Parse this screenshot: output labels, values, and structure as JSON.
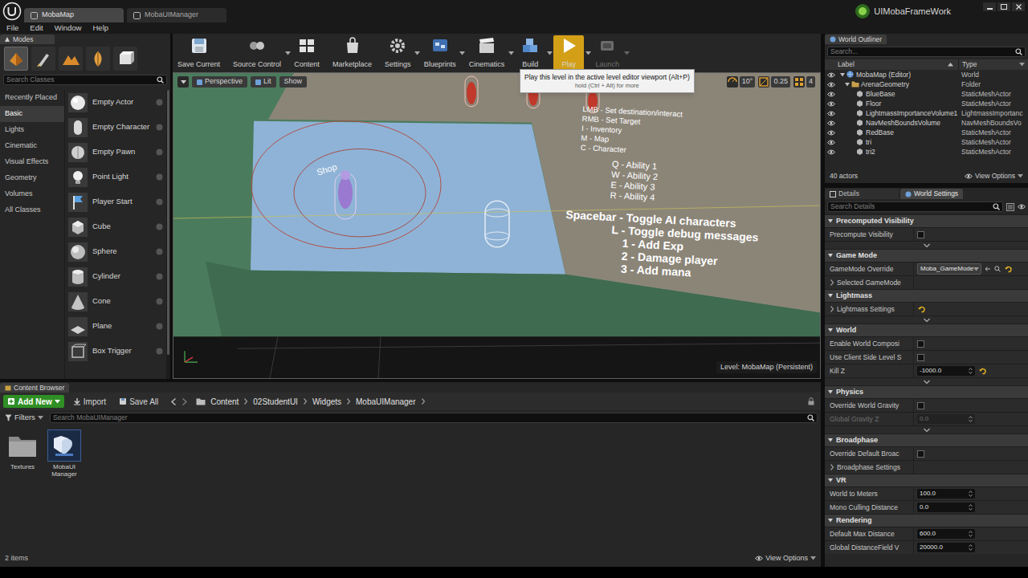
{
  "title_bar": {
    "tabs": [
      {
        "label": "MobaMap",
        "selected": true
      },
      {
        "label": "MobaUIManager",
        "selected": false
      }
    ],
    "project": "UIMobaFrameWork"
  },
  "menu": [
    "File",
    "Edit",
    "Window",
    "Help"
  ],
  "modes": {
    "title": "Modes",
    "tools": [
      {
        "selected": true
      },
      {
        "selected": false
      },
      {
        "selected": false
      },
      {
        "selected": false
      },
      {
        "selected": false
      }
    ],
    "search_placeholder": "Search Classes",
    "categories": [
      {
        "label": "Recently Placed",
        "selected": false
      },
      {
        "label": "Basic",
        "selected": true
      },
      {
        "label": "Lights",
        "selected": false
      },
      {
        "label": "Cinematic",
        "selected": false
      },
      {
        "label": "Visual Effects",
        "selected": false
      },
      {
        "label": "Geometry",
        "selected": false
      },
      {
        "label": "Volumes",
        "selected": false
      },
      {
        "label": "All Classes",
        "selected": false
      }
    ],
    "items": [
      "Empty Actor",
      "Empty Character",
      "Empty Pawn",
      "Point Light",
      "Player Start",
      "Cube",
      "Sphere",
      "Cylinder",
      "Cone",
      "Plane",
      "Box Trigger"
    ]
  },
  "toolbar": [
    {
      "label": "Save Current",
      "dropdown": false,
      "selected": false,
      "disabled": false
    },
    {
      "label": "Source Control",
      "dropdown": true,
      "selected": false,
      "disabled": false
    },
    {
      "label": "Content",
      "dropdown": false,
      "selected": false,
      "disabled": false
    },
    {
      "label": "Marketplace",
      "dropdown": false,
      "selected": false,
      "disabled": false
    },
    {
      "label": "Settings",
      "dropdown": true,
      "selected": false,
      "disabled": false
    },
    {
      "label": "Blueprints",
      "dropdown": true,
      "selected": false,
      "disabled": false
    },
    {
      "label": "Cinematics",
      "dropdown": true,
      "selected": false,
      "disabled": false
    },
    {
      "label": "Build",
      "dropdown": true,
      "selected": false,
      "disabled": false
    },
    {
      "label": "Play",
      "dropdown": true,
      "selected": true,
      "disabled": false
    },
    {
      "label": "Launch",
      "dropdown": true,
      "selected": false,
      "disabled": true
    }
  ],
  "tooltip": {
    "title": "Play this level in the active level editor viewport (Alt+P)",
    "hint": "hold (Ctrl + Alt) for more"
  },
  "viewport": {
    "view_buttons": [
      "Perspective",
      "Lit",
      "Show"
    ],
    "snap": [
      "10°",
      "0.25",
      "4"
    ],
    "level_label": "Level:  MobaMap (Persistent)",
    "shop_label": "Shop",
    "floor_text": [
      "LMB - Set destination/interact",
      "RMB - Set Target",
      "I - Inventory",
      "M - Map",
      "C - Character",
      "Q - Ability 1",
      "W - Ability 2",
      "E - Ability 3",
      "R - Ability 4",
      "Spacebar  - Toggle AI characters",
      "L - Toggle debug messages",
      "1 - Add Exp",
      "2 - Damage player",
      "3 - Add mana"
    ]
  },
  "outliner": {
    "title": "World Outliner",
    "search_placeholder": "Search...",
    "columns": [
      "Label",
      "Type"
    ],
    "rows": [
      {
        "label": "MobaMap (Editor)",
        "type": "World",
        "depth": 0,
        "kind": "world",
        "expanded": true,
        "visible": true
      },
      {
        "label": "ArenaGeometry",
        "type": "Folder",
        "depth": 1,
        "kind": "folder",
        "expanded": true,
        "visible": true
      },
      {
        "label": "BlueBase",
        "type": "StaticMeshActor",
        "depth": 2,
        "kind": "actor",
        "expanded": false,
        "visible": true
      },
      {
        "label": "Floor",
        "type": "StaticMeshActor",
        "depth": 2,
        "kind": "actor",
        "expanded": false,
        "visible": true
      },
      {
        "label": "LightmassImportanceVolume1",
        "type": "LightmassImportanc",
        "depth": 2,
        "kind": "actor",
        "expanded": false,
        "visible": true
      },
      {
        "label": "NavMeshBoundsVolume",
        "type": "NavMeshBoundsVo",
        "depth": 2,
        "kind": "actor",
        "expanded": false,
        "visible": true
      },
      {
        "label": "RedBase",
        "type": "StaticMeshActor",
        "depth": 2,
        "kind": "actor",
        "expanded": false,
        "visible": true
      },
      {
        "label": "tri",
        "type": "StaticMeshActor",
        "depth": 2,
        "kind": "actor",
        "expanded": false,
        "visible": true
      },
      {
        "label": "tri2",
        "type": "StaticMeshActor",
        "depth": 2,
        "kind": "actor",
        "expanded": false,
        "visible": true
      }
    ],
    "count": "40 actors",
    "view_options": "View Options"
  },
  "details": {
    "tabs": [
      {
        "label": "Details",
        "selected": false
      },
      {
        "label": "World Settings",
        "selected": true
      }
    ],
    "search_placeholder": "Search Details",
    "sections": [
      {
        "title": "Precomputed Visibility",
        "expanded": true,
        "advanced": true,
        "rows": [
          {
            "kind": "checkbox",
            "label": "Precompute Visibility",
            "checked": false,
            "disabled": false,
            "modified": false
          }
        ]
      },
      {
        "title": "Game Mode",
        "expanded": true,
        "advanced": false,
        "rows": [
          {
            "kind": "dropdown",
            "label": "GameMode Override",
            "value": "Moba_GameMode",
            "disabled": false,
            "modified": true
          },
          {
            "kind": "group",
            "label": "Selected GameMode",
            "disabled": false,
            "modified": false
          }
        ]
      },
      {
        "title": "Lightmass",
        "expanded": true,
        "advanced": true,
        "rows": [
          {
            "kind": "group",
            "label": "Lightmass Settings",
            "disabled": false,
            "modified": true
          }
        ]
      },
      {
        "title": "World",
        "expanded": true,
        "advanced": true,
        "rows": [
          {
            "kind": "checkbox",
            "label": "Enable World Composi",
            "checked": false,
            "disabled": false,
            "modified": false
          },
          {
            "kind": "checkbox",
            "label": "Use Client Side Level S",
            "checked": false,
            "disabled": false,
            "modified": false
          },
          {
            "kind": "number",
            "label": "Kill Z",
            "value": "-1000.0",
            "disabled": false,
            "modified": true
          }
        ]
      },
      {
        "title": "Physics",
        "expanded": true,
        "advanced": true,
        "rows": [
          {
            "kind": "checkbox",
            "label": "Override World Gravity",
            "checked": false,
            "disabled": false,
            "modified": false
          },
          {
            "kind": "number",
            "label": "Global Gravity Z",
            "value": "0.0",
            "disabled": true,
            "modified": false
          }
        ]
      },
      {
        "title": "Broadphase",
        "expanded": true,
        "advanced": false,
        "rows": [
          {
            "kind": "checkbox",
            "label": "Override Default Broac",
            "checked": false,
            "disabled": false,
            "modified": false
          },
          {
            "kind": "group",
            "label": "Broadphase Settings",
            "disabled": false,
            "modified": false
          }
        ]
      },
      {
        "title": "VR",
        "expanded": true,
        "advanced": false,
        "rows": [
          {
            "kind": "number",
            "label": "World to Meters",
            "value": "100.0",
            "disabled": false,
            "modified": false
          },
          {
            "kind": "number",
            "label": "Mono Culling Distance",
            "value": "0.0",
            "disabled": false,
            "modified": false
          }
        ]
      },
      {
        "title": "Rendering",
        "expanded": true,
        "advanced": false,
        "rows": [
          {
            "kind": "number",
            "label": "Default Max Distance",
            "value": "600.0",
            "disabled": false,
            "modified": false
          },
          {
            "kind": "number",
            "label": "Global DistanceField V",
            "value": "20000.0",
            "disabled": false,
            "modified": false
          }
        ]
      }
    ]
  },
  "content_browser": {
    "title": "Content Browser",
    "buttons": [
      "Add New",
      "Import",
      "Save All"
    ],
    "path": [
      "Content",
      "02StudentUI",
      "Widgets",
      "MobaUIManager"
    ],
    "filters": "Filters",
    "search_placeholder": "Search MobaUIManager",
    "assets": [
      {
        "label": "Textures",
        "kind": "folder"
      },
      {
        "label": "MobaUI Manager",
        "kind": "widget"
      }
    ],
    "count": "2 items",
    "view_options": "View Options"
  }
}
